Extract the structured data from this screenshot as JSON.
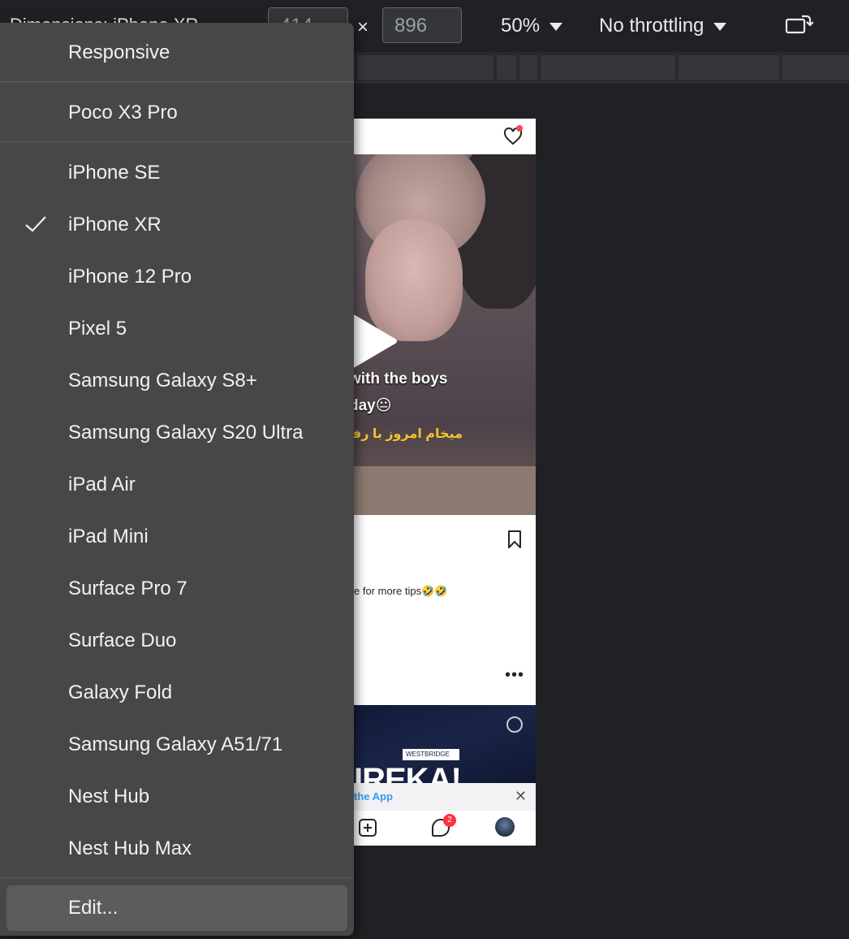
{
  "toolbar": {
    "dimensions_label": "Dimensions: iPhone XR",
    "width_value": "414",
    "height_value": "896",
    "times_symbol": "×",
    "zoom": "50%",
    "throttling": "No throttling",
    "rotate_icon": "rotate-icon"
  },
  "menu": {
    "items": [
      {
        "label": "Responsive",
        "checked": false
      },
      {
        "label": "Poco X3 Pro",
        "checked": false
      },
      {
        "label": "iPhone SE",
        "checked": false
      },
      {
        "label": "iPhone XR",
        "checked": true
      },
      {
        "label": "iPhone 12 Pro",
        "checked": false
      },
      {
        "label": "Pixel 5",
        "checked": false
      },
      {
        "label": "Samsung Galaxy S8+",
        "checked": false
      },
      {
        "label": "Samsung Galaxy S20 Ultra",
        "checked": false
      },
      {
        "label": "iPad Air",
        "checked": false
      },
      {
        "label": "iPad Mini",
        "checked": false
      },
      {
        "label": "Surface Pro 7",
        "checked": false
      },
      {
        "label": "Surface Duo",
        "checked": false
      },
      {
        "label": "Galaxy Fold",
        "checked": false
      },
      {
        "label": "Samsung Galaxy A51/71",
        "checked": false
      },
      {
        "label": "Nest Hub",
        "checked": false
      },
      {
        "label": "Nest Hub Max",
        "checked": false
      }
    ],
    "edit_label": "Edit..."
  },
  "phone": {
    "caption_line1": "with the boys",
    "caption_line2": "day😐",
    "caption_persian": "میخام امروز با رفیق",
    "post_caption": "e for more tips🤣🤣",
    "more_symbol": "•••",
    "ad_logo": "WESTBRIDGE",
    "ad_text": "IREKA!",
    "app_bar_text": "the App",
    "close_symbol": "✕",
    "messenger_badge": "2",
    "colors": {
      "notification_dot": "#ed4956",
      "badge": "#ff3040",
      "link_blue": "#3797f0",
      "persian_caption": "#f2c230"
    }
  }
}
